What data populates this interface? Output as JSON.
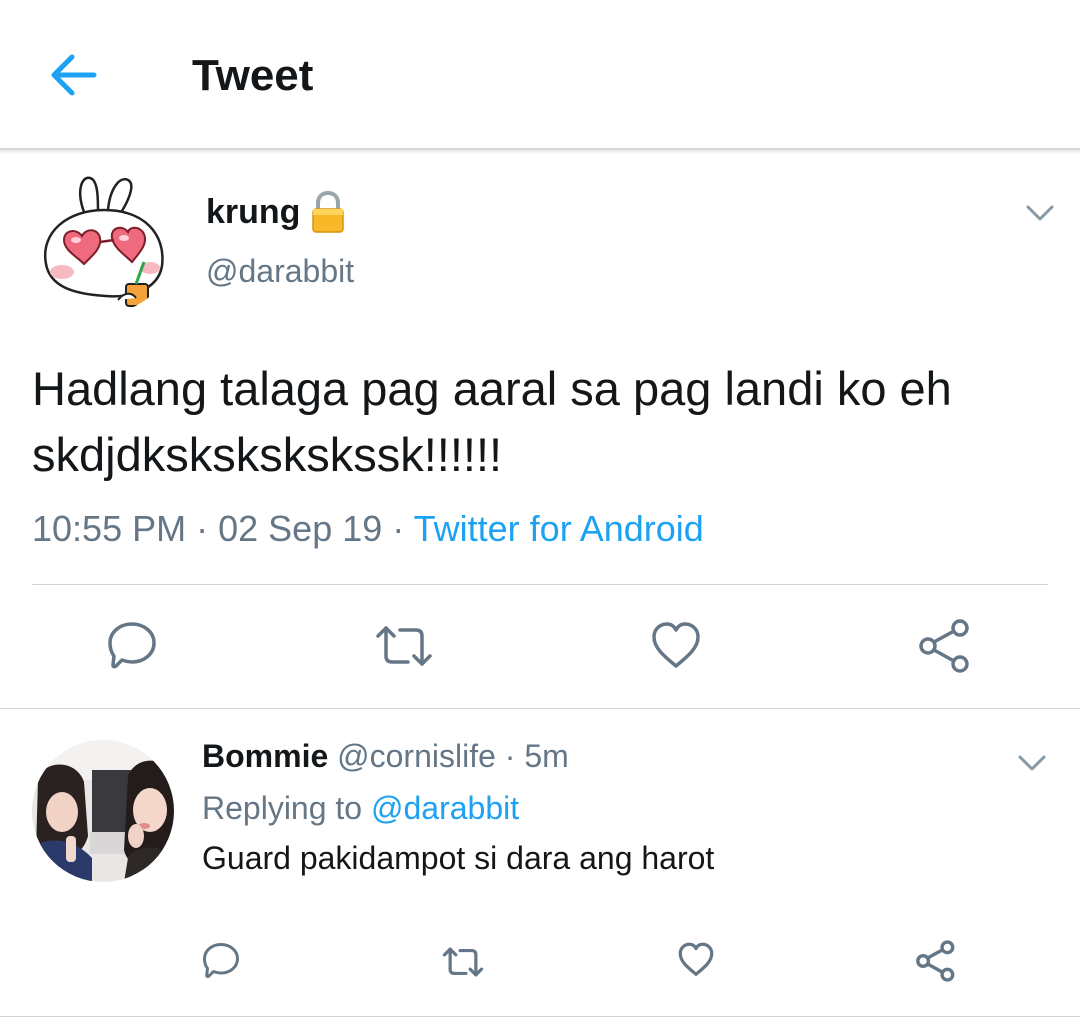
{
  "header": {
    "title": "Tweet",
    "back_icon": "arrow-left-icon",
    "accent_color": "#1da1f2"
  },
  "tweet": {
    "author_name": "krung",
    "author_handle": "@darabbit",
    "locked": true,
    "text": "Hadlang talaga pag aaral sa pag landi ko eh skdjdkskskskskssk!!!!!!",
    "time": "10:55 PM",
    "date": "02 Sep 19",
    "separator": "·",
    "source": "Twitter for Android",
    "actions": [
      "reply-icon",
      "retweet-icon",
      "like-icon",
      "share-icon"
    ]
  },
  "reply": {
    "author_name": "Bommie",
    "author_handle": "@cornislife",
    "separator": "·",
    "age": "5m",
    "replying_prefix": "Replying to",
    "replying_handle": "@darabbit",
    "text": "Guard pakidampot si dara ang harot",
    "actions": [
      "reply-icon",
      "retweet-icon",
      "like-icon",
      "share-icon"
    ]
  },
  "colors": {
    "text_primary": "#14171a",
    "text_secondary": "#657786",
    "link": "#1da1f2",
    "divider": "#ccd6dd"
  }
}
